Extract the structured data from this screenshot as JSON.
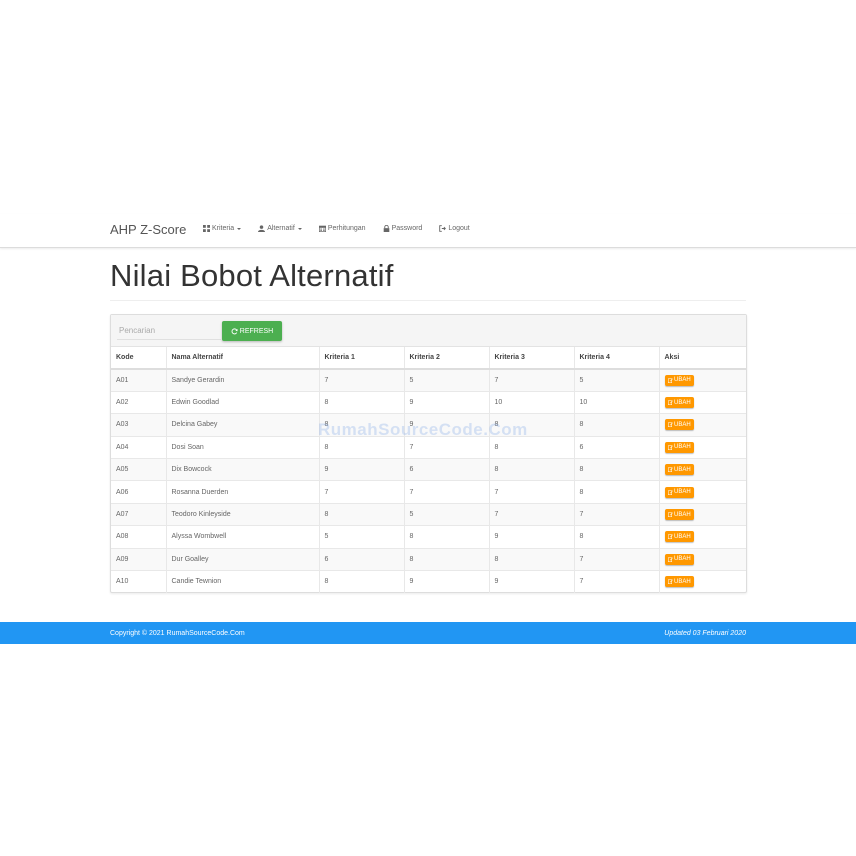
{
  "navbar": {
    "brand": "AHP Z-Score",
    "items": [
      {
        "label": "Kriteria",
        "icon": "grid-icon",
        "dropdown": true
      },
      {
        "label": "Alternatif",
        "icon": "user-icon",
        "dropdown": true
      },
      {
        "label": "Perhitungan",
        "icon": "calendar-icon",
        "dropdown": false
      },
      {
        "label": "Password",
        "icon": "lock-icon",
        "dropdown": false
      },
      {
        "label": "Logout",
        "icon": "logout-icon",
        "dropdown": false
      }
    ]
  },
  "page": {
    "title": "Nilai Bobot Alternatif"
  },
  "toolbar": {
    "search_placeholder": "Pencarian",
    "refresh_label": "REFRESH"
  },
  "table": {
    "headers": [
      "Kode",
      "Nama Alternatif",
      "Kriteria 1",
      "Kriteria 2",
      "Kriteria 3",
      "Kriteria 4",
      "Aksi"
    ],
    "action_label": "UBAH",
    "rows": [
      {
        "kode": "A01",
        "nama": "Sandye Gerardin",
        "k1": "7",
        "k2": "5",
        "k3": "7",
        "k4": "5"
      },
      {
        "kode": "A02",
        "nama": "Edwin Goodlad",
        "k1": "8",
        "k2": "9",
        "k3": "10",
        "k4": "10"
      },
      {
        "kode": "A03",
        "nama": "Delcina Gabey",
        "k1": "8",
        "k2": "9",
        "k3": "8",
        "k4": "8"
      },
      {
        "kode": "A04",
        "nama": "Dosi Soan",
        "k1": "8",
        "k2": "7",
        "k3": "8",
        "k4": "6"
      },
      {
        "kode": "A05",
        "nama": "Dix Bowcock",
        "k1": "9",
        "k2": "6",
        "k3": "8",
        "k4": "8"
      },
      {
        "kode": "A06",
        "nama": "Rosanna Duerden",
        "k1": "7",
        "k2": "7",
        "k3": "7",
        "k4": "8"
      },
      {
        "kode": "A07",
        "nama": "Teodoro Kinleyside",
        "k1": "8",
        "k2": "5",
        "k3": "7",
        "k4": "7"
      },
      {
        "kode": "A08",
        "nama": "Alyssa Wombwell",
        "k1": "5",
        "k2": "8",
        "k3": "9",
        "k4": "8"
      },
      {
        "kode": "A09",
        "nama": "Dur Goalley",
        "k1": "6",
        "k2": "8",
        "k3": "8",
        "k4": "7"
      },
      {
        "kode": "A10",
        "nama": "Candie Tewnion",
        "k1": "8",
        "k2": "9",
        "k3": "9",
        "k4": "7"
      }
    ]
  },
  "watermark": "RumahSourceCode.Com",
  "footer": {
    "copyright": "Copyright © 2021 RumahSourceCode.Com",
    "updated": "Updated 03 Februari 2020"
  },
  "colors": {
    "primary": "#2196f3",
    "success": "#4caf50",
    "warning": "#ff9800"
  }
}
